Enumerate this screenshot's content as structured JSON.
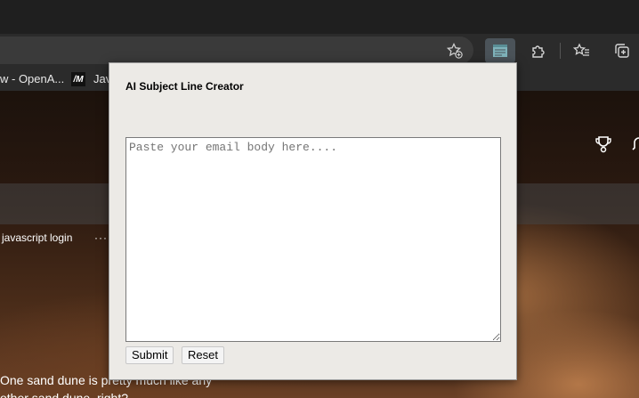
{
  "browser": {
    "bookmarks": [
      {
        "label": "w - OpenA..."
      },
      {
        "label": "Jav",
        "icon": "/M"
      }
    ],
    "toolbar_icons": [
      "favorite-add-icon",
      "extension-active-icon",
      "extensions-puzzle-icon",
      "favorites-icon",
      "collections-icon"
    ]
  },
  "page": {
    "nav_items": [
      "javascript login",
      "···"
    ],
    "body_lines": [
      "One sand dune is pretty much like any",
      "other sand dune, right?"
    ],
    "header_icons": [
      "trophy-icon",
      "bell-icon"
    ]
  },
  "popup": {
    "title": "AI Subject Line Creator",
    "textarea": {
      "value": "",
      "placeholder": "Paste your email body here...."
    },
    "submit_label": "Submit",
    "reset_label": "Reset"
  },
  "colors": {
    "chrome_dark": "#1f1f1f",
    "toolbar": "#2b2b2b",
    "popup_bg": "#eceae6",
    "active_extension": "#4b5359",
    "extension_icon": "#7fb3bb"
  }
}
